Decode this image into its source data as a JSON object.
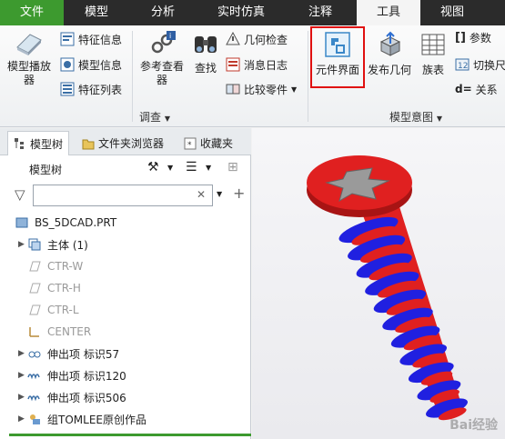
{
  "tabs": [
    "文件",
    "模型",
    "分析",
    "实时仿真",
    "注释",
    "工具",
    "视图"
  ],
  "ribbon": {
    "model_player": "模型播放器",
    "feature_info": "特征信息",
    "model_info": "模型信息",
    "feature_list": "特征列表",
    "ref_viewer": "参考查看器",
    "find": "查找",
    "geom_check": "几何检查",
    "msg_log": "消息日志",
    "compare_parts": "比较零件",
    "investigate_group": "调查",
    "component_interface": "元件界面",
    "publish_geometry": "发布几何",
    "family_table": "族表",
    "parameters": "参数",
    "switch_size": "切换尺",
    "relations": "关系",
    "model_intent_group": "模型意图"
  },
  "panel": {
    "tabs": [
      "模型树",
      "文件夹浏览器",
      "收藏夹"
    ],
    "tree_title": "模型树",
    "search": {
      "value": "",
      "placeholder": ""
    },
    "items": [
      {
        "label": "BS_5DCAD.PRT",
        "icon": "part-icon",
        "expandable": false,
        "dim": false
      },
      {
        "label": "主体 (1)",
        "icon": "body-icon",
        "expandable": true,
        "dim": false
      },
      {
        "label": "CTR-W",
        "icon": "datum-plane-icon",
        "expandable": false,
        "dim": true
      },
      {
        "label": "CTR-H",
        "icon": "datum-plane-icon",
        "expandable": false,
        "dim": true
      },
      {
        "label": "CTR-L",
        "icon": "datum-plane-icon",
        "expandable": false,
        "dim": true
      },
      {
        "label": "CENTER",
        "icon": "coordinate-system-icon",
        "expandable": false,
        "dim": true
      },
      {
        "label": "伸出项 标识57",
        "icon": "protrusion-icon",
        "expandable": true,
        "dim": false
      },
      {
        "label": "伸出项 标识120",
        "icon": "helical-sweep-icon",
        "expandable": true,
        "dim": false
      },
      {
        "label": "伸出项 标识506",
        "icon": "helical-sweep-icon",
        "expandable": true,
        "dim": false
      },
      {
        "label": "组TOMLEE原创作品",
        "icon": "group-icon",
        "expandable": true,
        "dim": false
      }
    ]
  },
  "viewport": {
    "watermark": "Bai经验"
  },
  "colors": {
    "file_tab": "#3d9a2f",
    "highlight": "#e01010",
    "screw_head": "#e02020",
    "thread": "#2020e0"
  }
}
